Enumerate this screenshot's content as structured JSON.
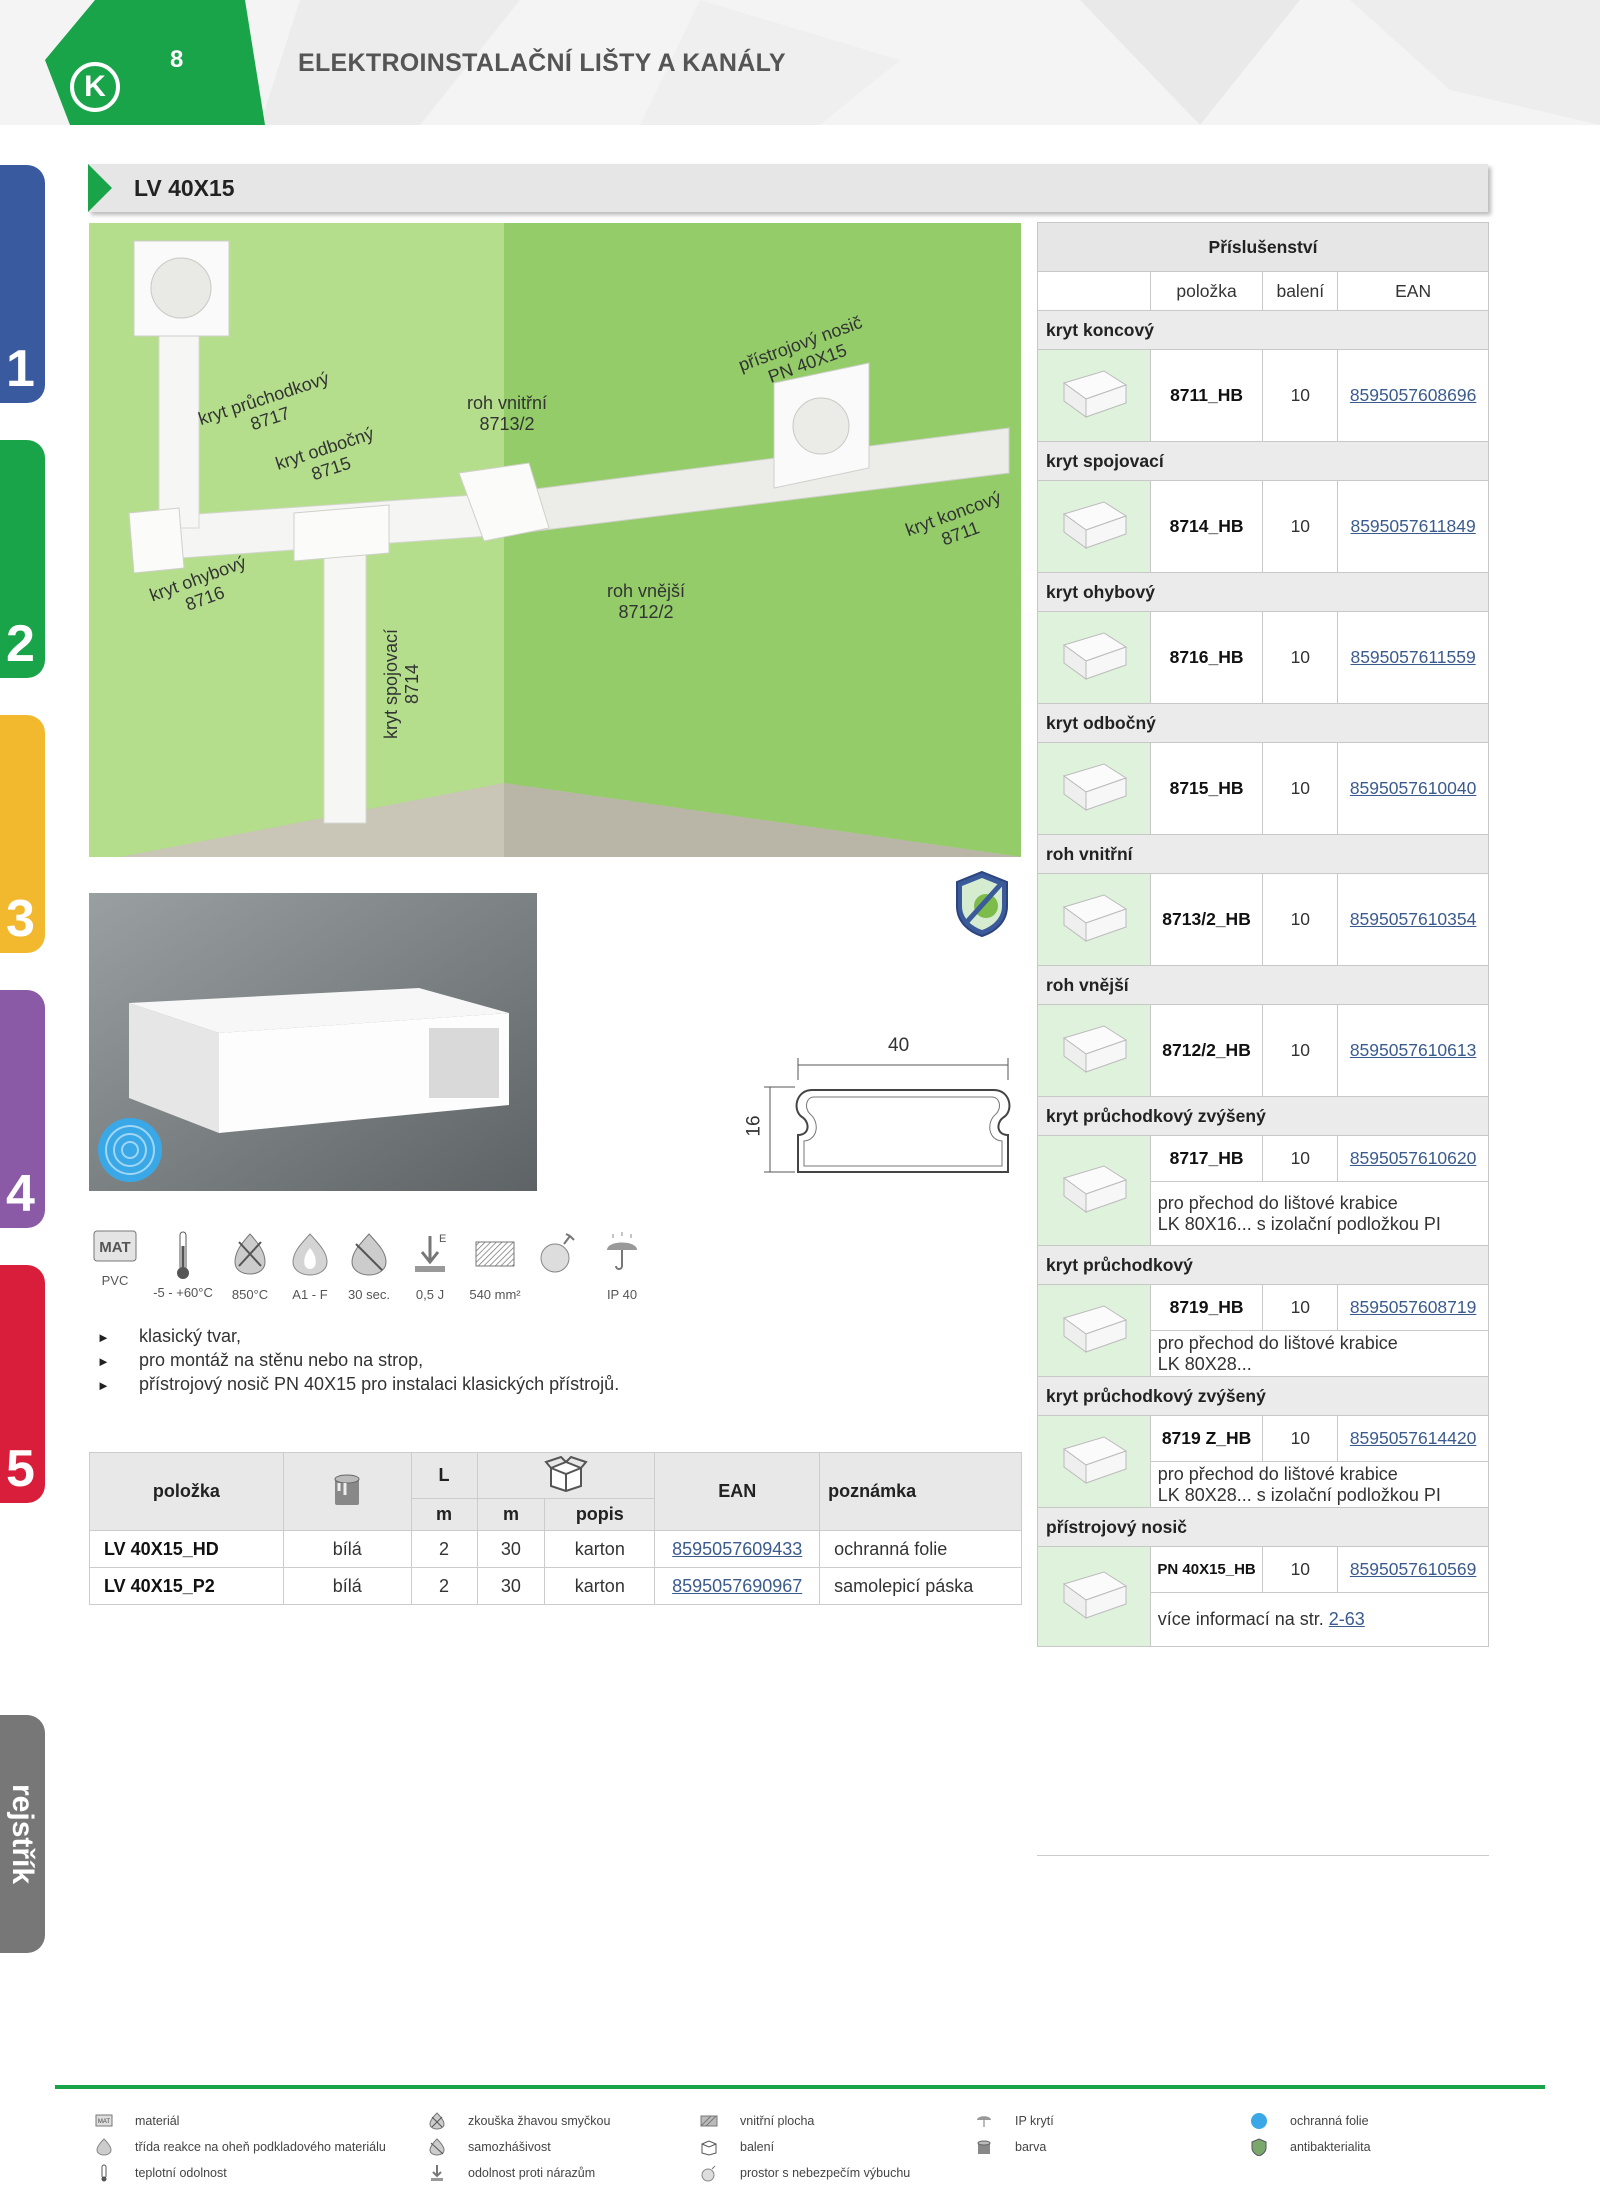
{
  "header": {
    "page_number": "8",
    "logo": "K",
    "chapter_title": "ELEKTROINSTALAČNÍ LIŠTY A KANÁLY"
  },
  "side_tabs": [
    {
      "label": "1",
      "color": "#3a5aa0"
    },
    {
      "label": "2",
      "color": "#1aa44a"
    },
    {
      "label": "3",
      "color": "#f2b92e"
    },
    {
      "label": "4",
      "color": "#8a5aa6"
    },
    {
      "label": "5",
      "color": "#d91e3b"
    }
  ],
  "index_tab": "rejstřík",
  "product": {
    "title": "LV 40X15",
    "scene_labels": {
      "pass": "kryt průchodkový\n8717",
      "branch": "kryt odbočný\n8715",
      "inner": "roh vnitřní\n8713/2",
      "carrier": "přístrojový nosič\nPN 40X15",
      "end": "kryt koncový\n8711",
      "bend": "kryt ohybový\n8716",
      "outer": "roh vnější\n8712/2",
      "joint": "kryt spojovací\n8714"
    },
    "dimension_width": "40",
    "dimension_height": "16",
    "specs": [
      {
        "icon": "material-icon",
        "label": "PVC"
      },
      {
        "icon": "thermometer-icon",
        "label": "-5 - +60°C"
      },
      {
        "icon": "glow-wire-icon",
        "label": "850°C"
      },
      {
        "icon": "flame-icon",
        "label": "A1 - F"
      },
      {
        "icon": "self-extinguishing-icon",
        "label": "30 sec."
      },
      {
        "icon": "impact-icon",
        "label": "0,5 J"
      },
      {
        "icon": "inner-area-icon",
        "label": "540 mm²"
      },
      {
        "icon": "explosion-icon",
        "label": ""
      },
      {
        "icon": "ip-icon",
        "label": "IP 40"
      }
    ],
    "bullets": [
      "klasický tvar,",
      "pro montáž na stěnu nebo na strop,",
      "přístrojový nosič PN 40X15 pro instalaci klasických přístrojů."
    ],
    "table": {
      "headers": {
        "item": "položka",
        "L": "L",
        "m1": "m",
        "m2": "m",
        "popis": "popis",
        "ean": "EAN",
        "note": "poznámka"
      },
      "rows": [
        {
          "item": "LV 40X15_HD",
          "color": "bílá",
          "L": "2",
          "m": "30",
          "popis": "karton",
          "ean": "8595057609433",
          "note": "ochranná folie"
        },
        {
          "item": "LV 40X15_P2",
          "color": "bílá",
          "L": "2",
          "m": "30",
          "popis": "karton",
          "ean": "8595057690967",
          "note": "samolepicí páska"
        }
      ]
    }
  },
  "accessories": {
    "title": "Příslušenství",
    "col_item": "položka",
    "col_pack": "balení",
    "col_ean": "EAN",
    "groups": [
      {
        "category": "kryt koncový",
        "code": "8711_HB",
        "pack": "10",
        "ean": "8595057608696",
        "note": ""
      },
      {
        "category": "kryt spojovací",
        "code": "8714_HB",
        "pack": "10",
        "ean": "8595057611849",
        "note": ""
      },
      {
        "category": "kryt ohybový",
        "code": "8716_HB",
        "pack": "10",
        "ean": "8595057611559",
        "note": ""
      },
      {
        "category": "kryt odbočný",
        "code": "8715_HB",
        "pack": "10",
        "ean": "8595057610040",
        "note": ""
      },
      {
        "category": "roh vnitřní",
        "code": "8713/2_HB",
        "pack": "10",
        "ean": "8595057610354",
        "note": ""
      },
      {
        "category": "roh vnější",
        "code": "8712/2_HB",
        "pack": "10",
        "ean": "8595057610613",
        "note": ""
      },
      {
        "category": "kryt průchodkový zvýšený",
        "code": "8717_HB",
        "pack": "10",
        "ean": "8595057610620",
        "note": "pro přechod do lištové krabice\nLK 80X16... s izolační podložkou PI"
      },
      {
        "category": "kryt průchodkový",
        "code": "8719_HB",
        "pack": "10",
        "ean": "8595057608719",
        "note": "pro přechod do lištové krabice\nLK 80X28..."
      },
      {
        "category": "kryt průchodkový zvýšený",
        "code": "8719 Z_HB",
        "pack": "10",
        "ean": "8595057614420",
        "note": "pro přechod do lištové krabice\nLK 80X28... s izolační podložkou PI"
      },
      {
        "category": "přístrojový nosič",
        "code": "PN 40X15_HB",
        "pack": "10",
        "ean": "8595057610569",
        "note": "",
        "more_text": "více informací na str. ",
        "more_link": "2-63"
      }
    ]
  },
  "legend": [
    {
      "icon": "material-icon",
      "text": "materiál"
    },
    {
      "icon": "flame-icon",
      "text": "třída reakce na oheň podkladového materiálu"
    },
    {
      "icon": "thermometer-icon",
      "text": "teplotní odolnost"
    },
    {
      "icon": "glow-wire-icon",
      "text": "zkouška žhavou smyčkou"
    },
    {
      "icon": "self-extinguishing-icon",
      "text": "samozhášivost"
    },
    {
      "icon": "impact-icon",
      "text": "odolnost proti nárazům"
    },
    {
      "icon": "inner-area-icon",
      "text": "vnitřní plocha"
    },
    {
      "icon": "box-icon",
      "text": "balení"
    },
    {
      "icon": "explosion-icon",
      "text": "prostor s nebezpečím výbuchu"
    },
    {
      "icon": "ip-icon",
      "text": "IP krytí"
    },
    {
      "icon": "paint-bucket-icon",
      "text": "barva"
    },
    {
      "icon": "protective-foil-icon",
      "text": "ochranná folie"
    },
    {
      "icon": "antibacterial-icon",
      "text": "antibakterialita"
    }
  ],
  "colors": {
    "green": "#1aa44a",
    "wall_light": "#b2dc8a",
    "wall_dark": "#8fc869",
    "link": "#3b5b8f"
  }
}
